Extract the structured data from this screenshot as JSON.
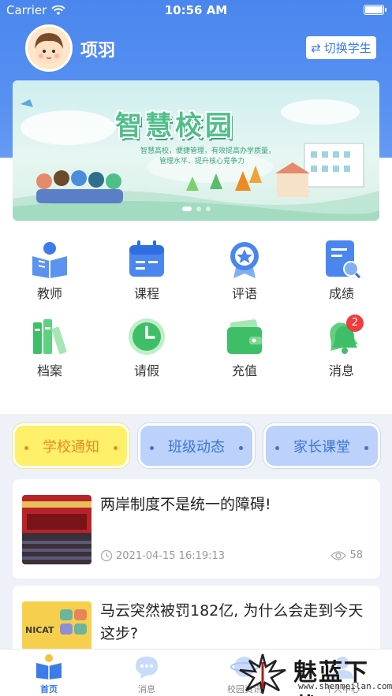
{
  "status_bar": {
    "carrier": "Carrier",
    "time": "10:56 AM"
  },
  "profile": {
    "name": "项羽",
    "switch_label": "切换学生"
  },
  "banner": {
    "title": "智慧校园",
    "subtitle_line1": "智慧高校，便捷管理，有效提高办学质量，",
    "subtitle_line2": "管理水平、提升核心竞争力"
  },
  "menu": [
    {
      "label": "教师",
      "icon": "teacher-reading-icon"
    },
    {
      "label": "课程",
      "icon": "calendar-icon"
    },
    {
      "label": "评语",
      "icon": "award-medal-icon"
    },
    {
      "label": "成绩",
      "icon": "report-search-icon"
    },
    {
      "label": "档案",
      "icon": "books-archive-icon"
    },
    {
      "label": "请假",
      "icon": "clock-icon"
    },
    {
      "label": "充值",
      "icon": "wallet-icon"
    },
    {
      "label": "消息",
      "icon": "bell-icon",
      "badge": "2"
    }
  ],
  "tabs": [
    {
      "label": "学校通知",
      "active": true
    },
    {
      "label": "班级动态",
      "active": false
    },
    {
      "label": "家长课堂",
      "active": false
    }
  ],
  "news": [
    {
      "title": "两岸制度不是统一的障碍!",
      "time": "2021-04-15 16:19:13",
      "views": "58"
    },
    {
      "title": "马云突然被罚182亿, 为什么会走到今天这步?",
      "time": "",
      "views": ""
    }
  ],
  "bottom_nav": [
    {
      "label": "首页",
      "active": true
    },
    {
      "label": "消息",
      "active": false
    },
    {
      "label": "校园资讯",
      "active": false
    },
    {
      "label": "个人中心",
      "active": false
    }
  ],
  "watermark": {
    "text": "魅蓝下载",
    "url": "www.shenmeilan.com"
  },
  "colors": {
    "primary": "#4a86ee",
    "accent_yellow": "#fff06a",
    "accent_orange": "#ef8a23",
    "badge_red": "#f03c3c"
  }
}
